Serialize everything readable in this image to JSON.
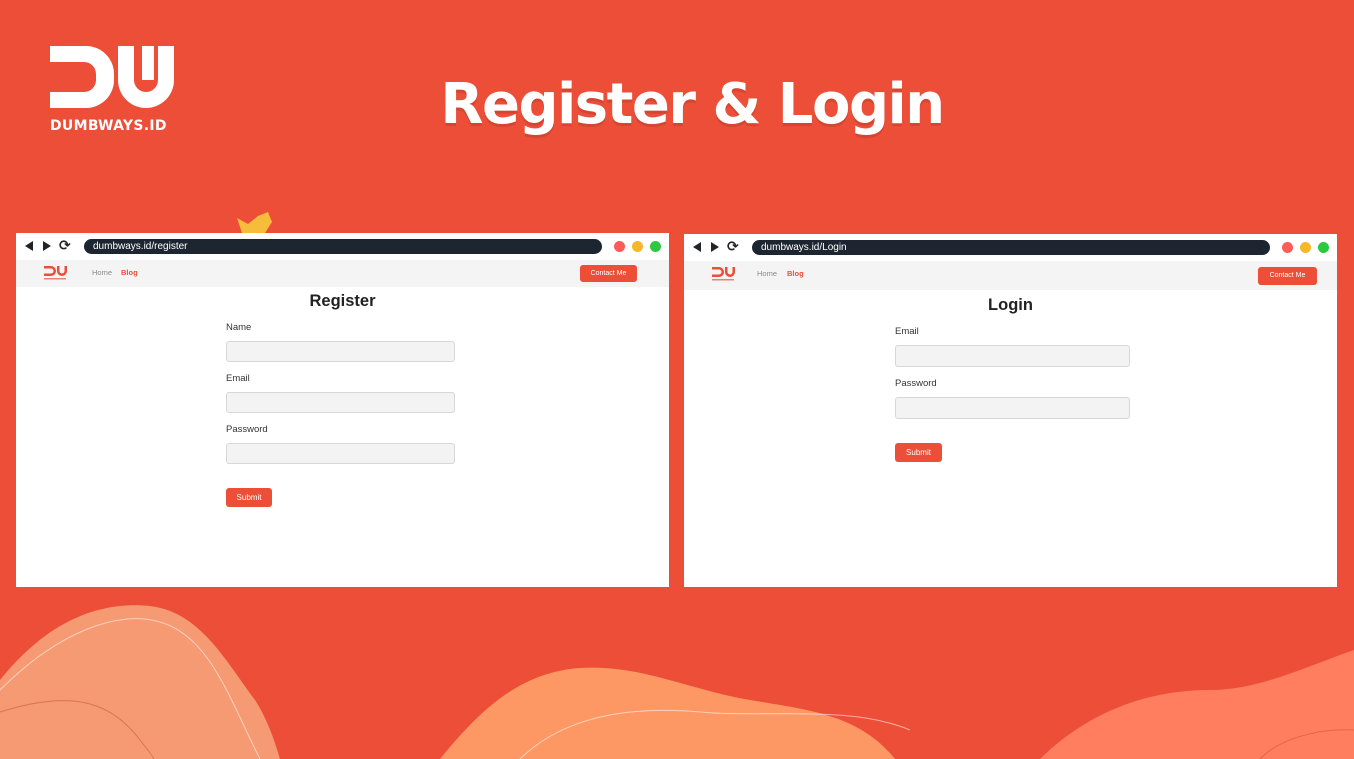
{
  "slide": {
    "logo_text": "DUMBWAYS.ID",
    "title": "Register & Login"
  },
  "colors": {
    "background": "#EC4E38",
    "accent": "#EC4E38",
    "url_bar": "#1D2630",
    "dot_red": "#FF5B57",
    "dot_yellow": "#F6B72A",
    "dot_green": "#2BC840",
    "field_fill": "#F3F3F3"
  },
  "register_window": {
    "url": "dumbways.id/register",
    "nav": {
      "home": "Home",
      "blog": "Blog",
      "contact": "Contact Me"
    },
    "form": {
      "title": "Register",
      "name_label": "Name",
      "name_value": "",
      "email_label": "Email",
      "email_value": "",
      "password_label": "Password",
      "password_value": "",
      "submit": "Submit"
    }
  },
  "login_window": {
    "url": "dumbways.id/Login",
    "nav": {
      "home": "Home",
      "blog": "Blog",
      "contact": "Contact Me"
    },
    "form": {
      "title": "Login",
      "email_label": "Email",
      "email_value": "",
      "password_label": "Password",
      "password_value": "",
      "submit": "Submit"
    }
  },
  "icons": [
    "back-arrow-icon",
    "forward-arrow-icon",
    "refresh-icon",
    "window-close-dot",
    "window-minimize-dot",
    "window-maximize-dot",
    "star-icon"
  ]
}
